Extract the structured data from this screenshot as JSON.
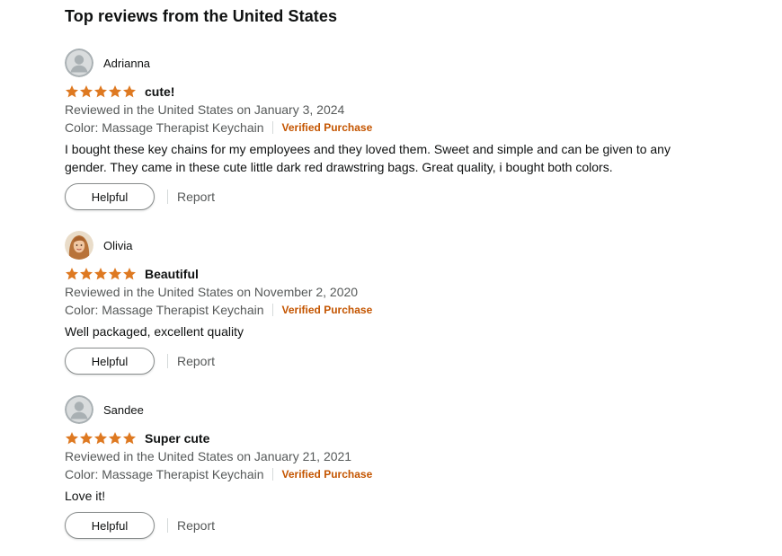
{
  "section": {
    "heading": "Top reviews from the United States"
  },
  "colors": {
    "star": "#de7921",
    "verified": "#c45500",
    "secondary_text": "#565959"
  },
  "reviews": [
    {
      "profile_name": "Adrianna",
      "avatar": "default-user-icon",
      "rating": 5,
      "rating_max": 5,
      "title": "cute!",
      "date": "Reviewed in the United States on January 3, 2024",
      "variant": "Color: Massage Therapist Keychain",
      "verified": "Verified Purchase",
      "body": "I bought these key chains for my employees and they loved them. Sweet and simple and can be given to any gender. They came in these cute little dark red drawstring bags. Great quality, i bought both colors.",
      "helpful_label": "Helpful",
      "report_label": "Report"
    },
    {
      "profile_name": "Olivia",
      "avatar": "user-photo",
      "rating": 5,
      "rating_max": 5,
      "title": "Beautiful",
      "date": "Reviewed in the United States on November 2, 2020",
      "variant": "Color: Massage Therapist Keychain",
      "verified": "Verified Purchase",
      "body": "Well packaged, excellent quality",
      "helpful_label": "Helpful",
      "report_label": "Report"
    },
    {
      "profile_name": "Sandee",
      "avatar": "default-user-icon",
      "rating": 5,
      "rating_max": 5,
      "title": "Super cute",
      "date": "Reviewed in the United States on January 21, 2021",
      "variant": "Color: Massage Therapist Keychain",
      "verified": "Verified Purchase",
      "body": "Love it!",
      "helpful_label": "Helpful",
      "report_label": "Report"
    }
  ]
}
